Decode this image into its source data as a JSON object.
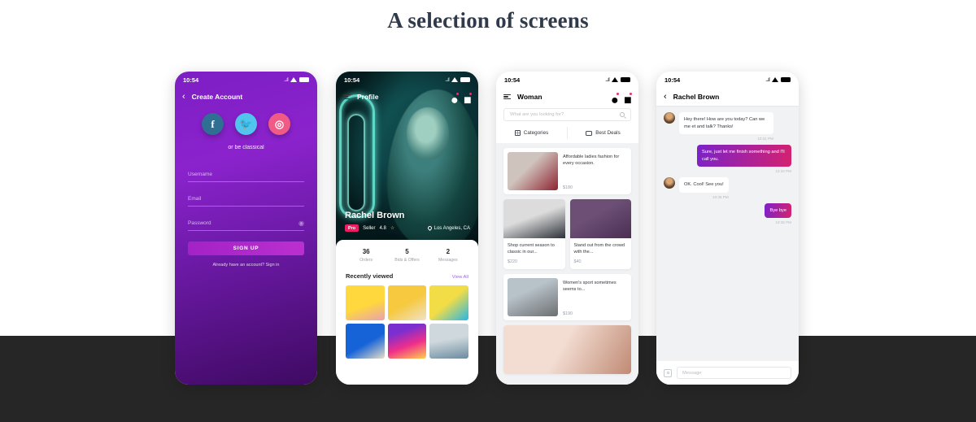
{
  "page": {
    "title": "A selection of screens"
  },
  "phone1": {
    "status": {
      "time": "10:54"
    },
    "nav": {
      "back": "‹",
      "title": "Create Account"
    },
    "socials": [
      {
        "name": "facebook",
        "glyph": "f"
      },
      {
        "name": "twitter",
        "glyph": "🐦"
      },
      {
        "name": "dribbble",
        "glyph": "◎"
      }
    ],
    "or_text": "or be classical",
    "fields": [
      {
        "label": "Username"
      },
      {
        "label": "Email"
      },
      {
        "label": "Password"
      }
    ],
    "signup_label": "SIGN UP",
    "signin_text": "Already have an account? Sign in"
  },
  "phone2": {
    "status": {
      "time": "10:54"
    },
    "nav": {
      "title": "Profile"
    },
    "name": "Rachel Brown",
    "badge": "Pro",
    "seller_label": "Seller",
    "rating": "4.8",
    "location": "Los Angeles, CA",
    "stats": [
      {
        "num": "36",
        "label": "Orders"
      },
      {
        "num": "5",
        "label": "Bids & Offers"
      },
      {
        "num": "2",
        "label": "Messages"
      }
    ],
    "section_title": "Recently viewed",
    "view_all": "View All",
    "thumbs": [
      "g1",
      "g2",
      "g3",
      "g4",
      "g5",
      "g6"
    ]
  },
  "phone3": {
    "status": {
      "time": "10:54"
    },
    "nav": {
      "title": "Woman"
    },
    "search_placeholder": "What are you looking for?",
    "tabs": [
      {
        "label": "Categories",
        "icon": "grid-icon"
      },
      {
        "label": "Best Deals",
        "icon": "camera-icon"
      }
    ],
    "products": [
      {
        "desc": "Affordable ladies fashion for every occasion.",
        "price": "$180"
      },
      {
        "desc": "Shop current season to classic in our...",
        "price": "$220"
      },
      {
        "desc": "Stand out from the crowd with the...",
        "price": "$40"
      },
      {
        "desc": "Women's sport sometimes seems to...",
        "price": "$190"
      }
    ]
  },
  "phone4": {
    "status": {
      "time": "10:54"
    },
    "nav": {
      "back": "‹",
      "title": "Rachel Brown"
    },
    "messages": [
      {
        "dir": "in",
        "text": "Hey there! How are you today? Can we me et and talk? Thanks!",
        "time": "10:31 PM"
      },
      {
        "dir": "out",
        "text": "Sure, just let me finish something and I'll call you.",
        "time": "10:34 PM"
      },
      {
        "dir": "in",
        "text": "OK. Cool! See you!",
        "time": "10:35 PM"
      },
      {
        "dir": "out",
        "text": "Bye bye",
        "time": "10:36 PM"
      }
    ],
    "composer_placeholder": "Message"
  }
}
